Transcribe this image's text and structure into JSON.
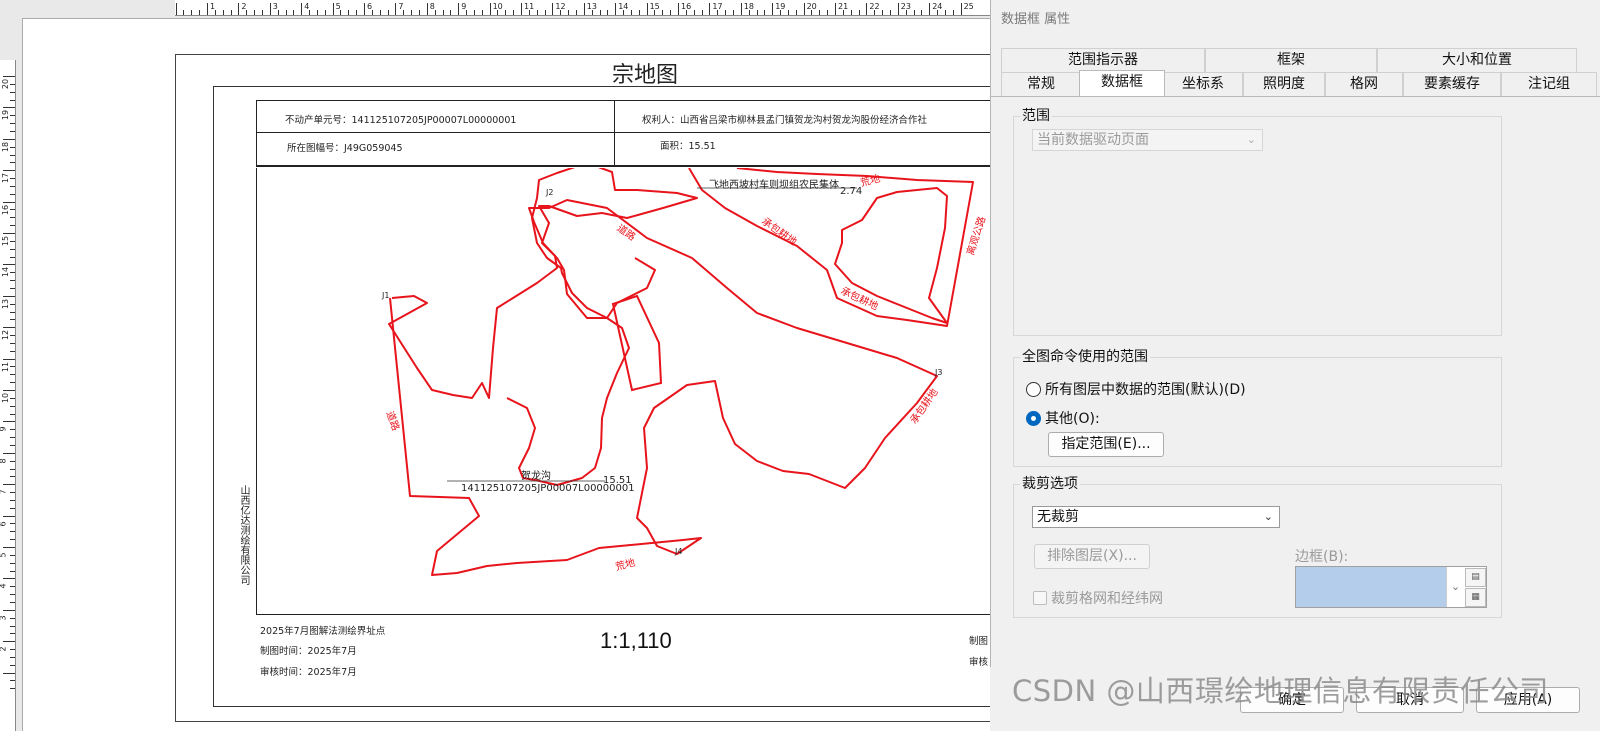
{
  "layout_view": {
    "ruler_top_numbers": [
      "1",
      "2",
      "3",
      "4",
      "5",
      "6",
      "7",
      "8",
      "9",
      "10",
      "11",
      "12",
      "13",
      "14",
      "15",
      "16",
      "17",
      "18",
      "19",
      "20",
      "21",
      "22",
      "23",
      "24",
      "25"
    ],
    "ruler_left_numbers": [
      "20",
      "19",
      "18",
      "17",
      "16",
      "15",
      "14",
      "13",
      "12",
      "11",
      "10",
      "9",
      "8",
      "7",
      "6",
      "5",
      "4",
      "3",
      "2"
    ],
    "map_title": "宗地图",
    "info": {
      "unit_no": "不动产单元号：141125107205JP00007L00000001",
      "owner": "权利人：山西省吕梁市柳林县孟门镇贺龙沟村贺龙沟股份经济合作社",
      "sheet_no": "所在图幅号：J49G059045",
      "area": "面积：15.51"
    },
    "map_labels": {
      "top_neighbor": "飞地西坡村车则坝组农民集体",
      "top_neighbor_value": "2.74",
      "road_top": "道路",
      "road_left": "道路",
      "contract_land_1": "承包耕地",
      "contract_land_2": "承包耕地",
      "contract_land_3": "承包耕地",
      "wasteland_top": "荒地",
      "wasteland_bottom": "荒地",
      "highway": "离观公路",
      "parcel_name": "贺龙沟",
      "parcel_code": "141125107205JP00007L00000001",
      "parcel_area": "15.51",
      "point_j1": "J1",
      "point_j2": "J2",
      "point_j3": "J3",
      "point_j4": "J4"
    },
    "company": "山西亿达测绘有限公司",
    "footer": {
      "survey_note": "2025年7月图解法测绘界址点",
      "draw_time": "制图时间：2025年7月",
      "review_time": "审核时间：2025年7月",
      "scale": "1:1,110",
      "right_line1": "制图",
      "right_line2": "审核"
    },
    "colors": {
      "boundary": "#e8141c",
      "frame": "#222222"
    }
  },
  "dialog": {
    "title": "数据框 属性",
    "tabs_row1": [
      "范围指示器",
      "框架",
      "大小和位置"
    ],
    "tabs_row2": [
      "常规",
      "数据框",
      "坐标系",
      "照明度",
      "格网",
      "要素缓存",
      "注记组"
    ],
    "active_tab": "数据框",
    "extent": {
      "group": "范围",
      "mode_value": "当前数据驱动页面"
    },
    "full_extent": {
      "group": "全图命令使用的范围",
      "option_all": "所有图层中数据的范围(默认)(D)",
      "option_other": "其他(O):",
      "selected": "其他(O):",
      "specify_button": "指定范围(E)..."
    },
    "clip": {
      "group": "裁剪选项",
      "value": "无裁剪",
      "exclude_button": "排除图层(X)...",
      "border_label": "边框(B):",
      "clip_grids_label": "裁剪格网和经纬网",
      "clip_grids_checked": false,
      "border_color": "#b3cdea"
    },
    "buttons": {
      "ok": "确定",
      "cancel": "取消",
      "apply": "应用(A)"
    },
    "watermark": "CSDN @山西璟绘地理信息有限责任公司"
  }
}
